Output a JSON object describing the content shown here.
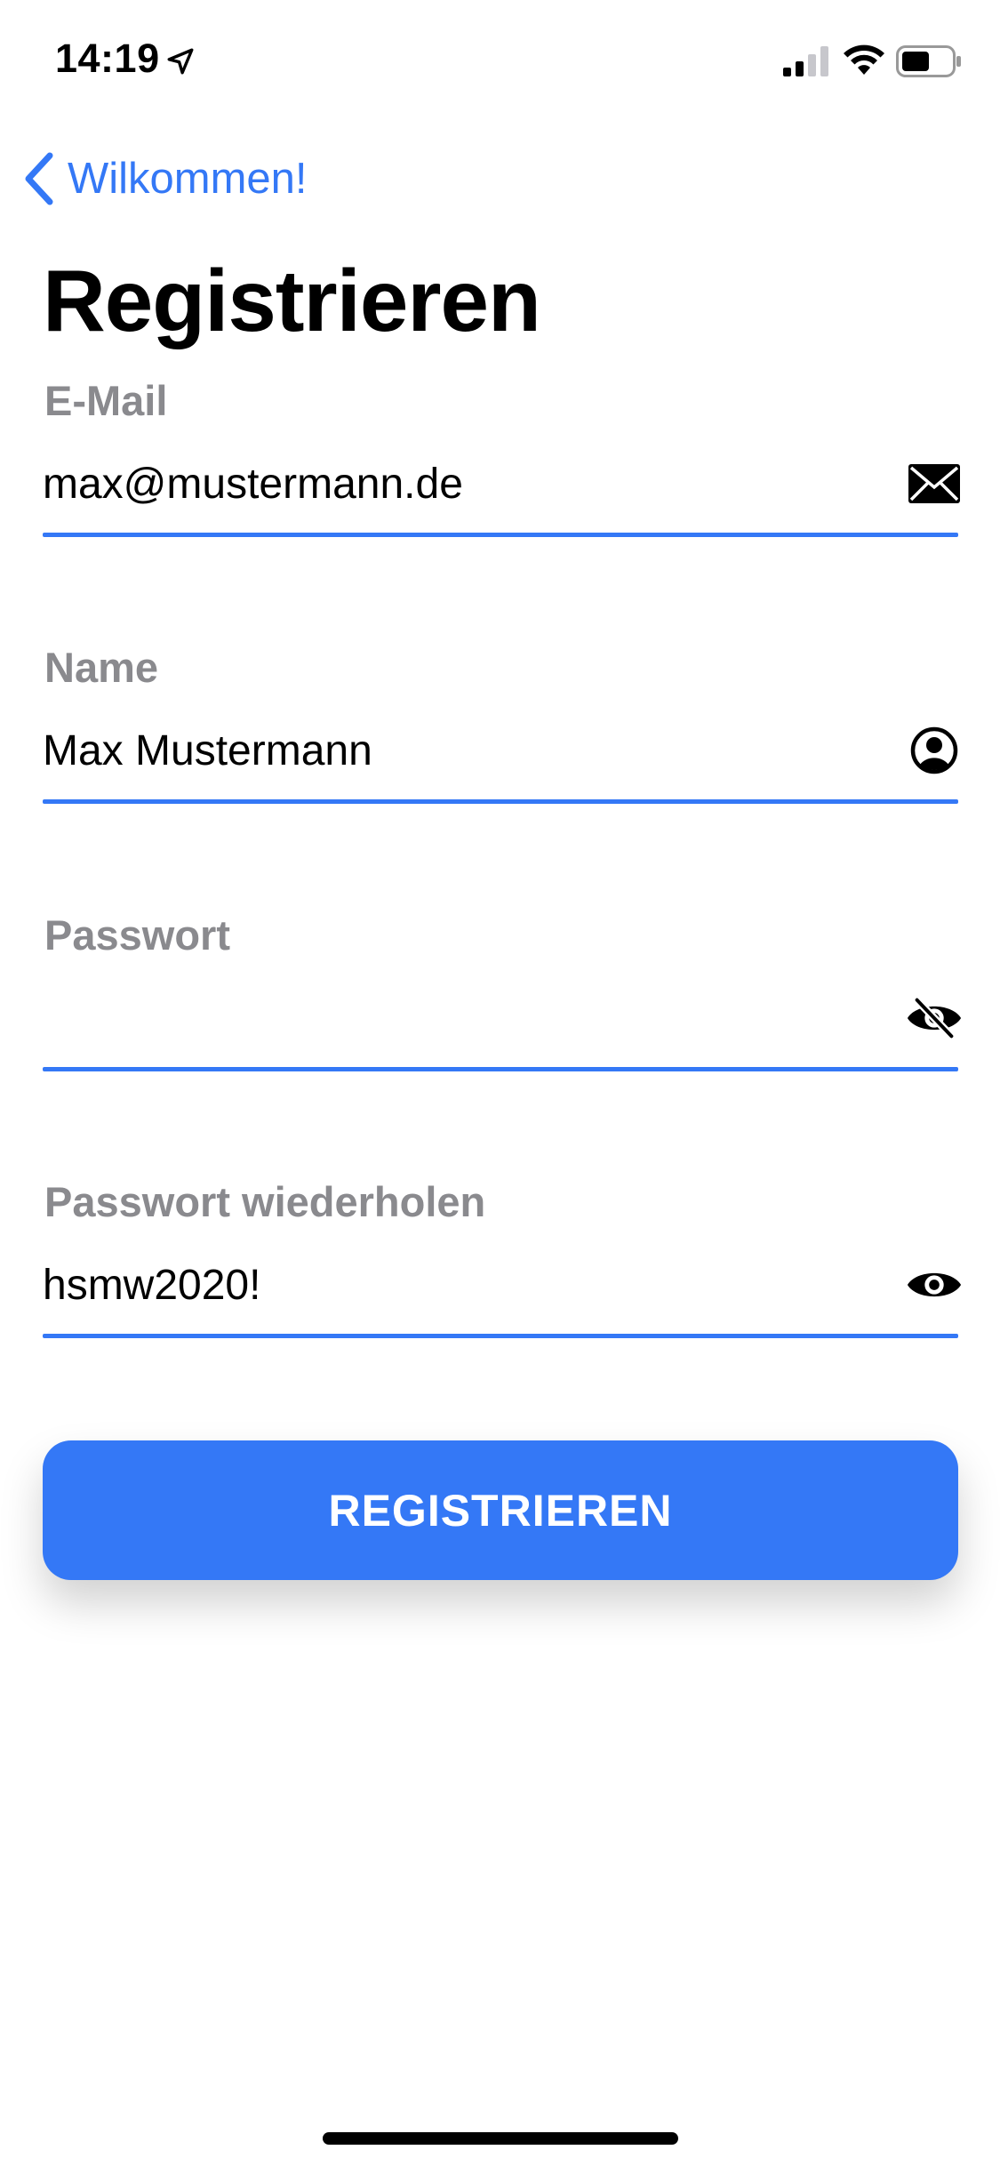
{
  "status_bar": {
    "time": "14:19"
  },
  "nav": {
    "back_label": "Wilkommen!",
    "title": "Registrieren"
  },
  "form": {
    "email": {
      "label": "E-Mail",
      "value": "max@mustermann.de",
      "icon": "envelope-icon"
    },
    "name": {
      "label": "Name",
      "value": "Max Mustermann",
      "icon": "user-circle-icon"
    },
    "password": {
      "label": "Passwort",
      "value": "",
      "icon": "eye-slash-icon"
    },
    "password_repeat": {
      "label": "Passwort wiederholen",
      "value": "hsmw2020!",
      "icon": "eye-icon"
    },
    "submit_label": "REGISTRIEREN"
  },
  "colors": {
    "accent": "#3478f6",
    "label_gray": "#8a8a8e",
    "text": "#000000",
    "background": "#ffffff"
  }
}
